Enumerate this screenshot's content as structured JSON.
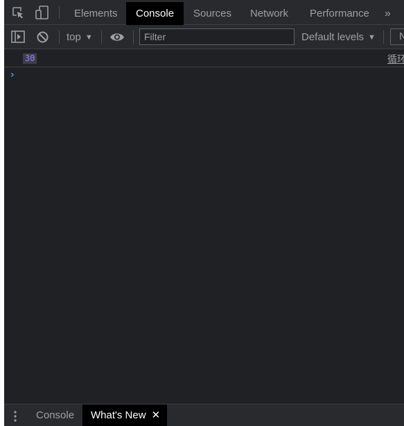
{
  "tabbar": {
    "icons": [
      "inspect-element-icon",
      "device-toolbar-icon"
    ],
    "tabs": [
      {
        "label": "Elements"
      },
      {
        "label": "Console"
      },
      {
        "label": "Sources"
      },
      {
        "label": "Network"
      },
      {
        "label": "Performance"
      }
    ],
    "active_tab": "Console",
    "more_tabs_glyph": "»"
  },
  "toolbar": {
    "context": "top",
    "filter_placeholder": "Filter",
    "levels_label": "Default levels",
    "caret_glyph": "▼",
    "issues_label": "No Issues"
  },
  "console": {
    "log_value": "30",
    "log_source": "循环"
  },
  "drawer": {
    "tabs": [
      {
        "label": "Console"
      },
      {
        "label": "What's New"
      }
    ],
    "active_tab": "What's New",
    "close_glyph": "✕"
  },
  "colors": {
    "background": "#202124",
    "toolbar": "#292a2d",
    "active_tab_bg": "#000000",
    "number_value": "#9980ff",
    "prompt": "#4e9bf0",
    "text_muted": "#9aa0a6"
  }
}
